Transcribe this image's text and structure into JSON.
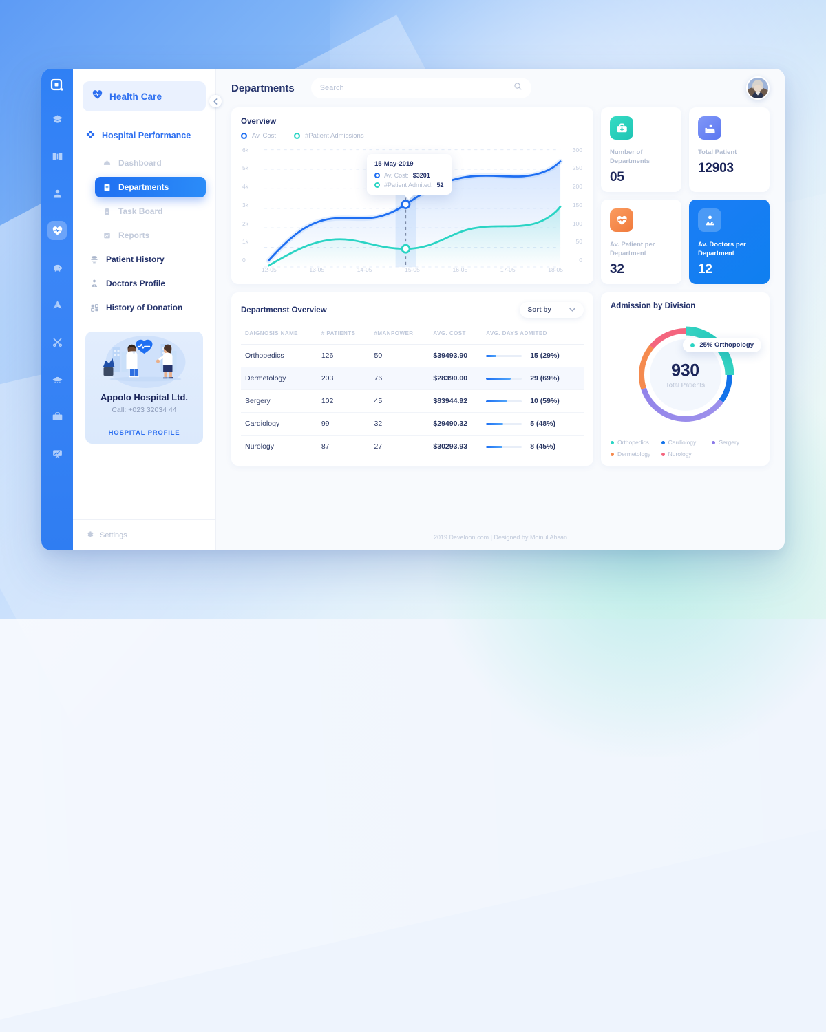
{
  "rail": {
    "logo_icon": "app-logo-icon",
    "items": [
      {
        "icon": "graduation-cap-icon",
        "active": false
      },
      {
        "icon": "book-open-icon",
        "active": false
      },
      {
        "icon": "user-badge-icon",
        "active": false
      },
      {
        "icon": "heart-pulse-icon",
        "active": true
      },
      {
        "icon": "piggy-bank-icon",
        "active": false
      },
      {
        "icon": "paper-plane-icon",
        "active": false
      },
      {
        "icon": "tools-icon",
        "active": false
      },
      {
        "icon": "ufo-icon",
        "active": false
      },
      {
        "icon": "briefcase-icon",
        "active": false
      },
      {
        "icon": "presentation-chart-icon",
        "active": false
      }
    ]
  },
  "sidebar": {
    "brand": {
      "label": "Health Care",
      "icon": "heart-pulse-icon"
    },
    "collapse_icon": "chevron-left-icon",
    "group_title": {
      "label": "Hospital Performance",
      "icon": "medical-cross-icon"
    },
    "items": [
      {
        "label": "Dashboard",
        "icon": "dashboard-icon",
        "active": false,
        "level": 2
      },
      {
        "label": "Departments",
        "icon": "departments-icon",
        "active": true,
        "level": 2
      },
      {
        "label": "Task Board",
        "icon": "task-board-icon",
        "active": false,
        "level": 2
      },
      {
        "label": "Reports",
        "icon": "reports-icon",
        "active": false,
        "level": 2
      },
      {
        "label": "Patient History",
        "icon": "patient-history-icon",
        "active": false,
        "level": 1
      },
      {
        "label": "Doctors Profile",
        "icon": "doctor-profile-icon",
        "active": false,
        "level": 1
      },
      {
        "label": "History of Donation",
        "icon": "donation-grid-icon",
        "active": false,
        "level": 1
      }
    ],
    "hospital_card": {
      "name": "Appolo Hospital Ltd.",
      "call": "Call: +023 32034 44",
      "button": "HOSPITAL PROFILE"
    },
    "settings": {
      "label": "Settings",
      "icon": "gear-icon"
    }
  },
  "topbar": {
    "title": "Departments",
    "search": {
      "value": "",
      "placeholder": "Search",
      "icon": "search-icon"
    },
    "avatar": "user-avatar"
  },
  "chart_data": {
    "type": "line",
    "title": "Overview",
    "x": [
      "12-05",
      "13-05",
      "14-05",
      "15-05",
      "16-05",
      "17-05",
      "18-05"
    ],
    "xlabel": "",
    "grid": true,
    "legend_position": "top-left",
    "series": [
      {
        "name": "Av. Cost",
        "color": "#1f6ff2",
        "axis": "left",
        "ylabel": "Av. Cost",
        "ylim": [
          0,
          6000
        ],
        "yticks": [
          "0",
          "1k",
          "2k",
          "3k",
          "4k",
          "5k",
          "6k"
        ],
        "values": [
          300,
          2450,
          2400,
          3201,
          4450,
          4350,
          5100
        ]
      },
      {
        "name": "#Patient Admissions",
        "color": "#2ad4c4",
        "axis": "right",
        "ylabel": "#Patient Admissions",
        "ylim": [
          0,
          300
        ],
        "yticks": [
          "0",
          "50",
          "100",
          "150",
          "200",
          "250",
          "300"
        ],
        "values": [
          12,
          88,
          72,
          52,
          110,
          130,
          152
        ]
      }
    ],
    "tooltip": {
      "date": "15-May-2019",
      "rows": [
        {
          "label": "Av. Cost:",
          "value": "$3201",
          "color": "#1f6ff2"
        },
        {
          "label": "#Patient Admited:",
          "value": "52",
          "color": "#2ad4c4"
        }
      ]
    }
  },
  "stats": [
    {
      "label": "Number of Departments",
      "value": "05",
      "icon": "medical-bag-icon",
      "icon_bg": "#2fd0bd",
      "accent": false
    },
    {
      "label": "Total Patient",
      "value": "12903",
      "icon": "patient-bed-icon",
      "icon_bg": "#6d8bf5",
      "accent": false
    },
    {
      "label": "Av. Patient per Department",
      "value": "32",
      "icon": "heart-beat-icon",
      "icon_bg": "#f58a4e",
      "accent": false
    },
    {
      "label": "Av. Doctors per Department",
      "value": "12",
      "icon": "doctor-icon",
      "icon_bg": "#ffffff",
      "accent": true
    }
  ],
  "table": {
    "title": "Departmenst Overview",
    "sort_by": {
      "label": "Sort by",
      "icon": "chevron-down-icon"
    },
    "columns": [
      "DAIGNOSIS NAME",
      "# PATIENTS",
      "#MANPOWER",
      "AVG. COST",
      "AVG. DAYS ADMITED"
    ],
    "rows": [
      {
        "name": "Orthopedics",
        "patients": "126",
        "manpower": "50",
        "cost": "$39493.90",
        "days": "15 (29%)",
        "pct": 29,
        "highlight": false
      },
      {
        "name": "Dermetology",
        "patients": "203",
        "manpower": "76",
        "cost": "$28390.00",
        "days": "29 (69%)",
        "pct": 69,
        "highlight": true
      },
      {
        "name": "Sergery",
        "patients": "102",
        "manpower": "45",
        "cost": "$83944.92",
        "days": "10 (59%)",
        "pct": 59,
        "highlight": false
      },
      {
        "name": "Cardiology",
        "patients": "99",
        "manpower": "32",
        "cost": "$29490.32",
        "days": "5 (48%)",
        "pct": 48,
        "highlight": false
      },
      {
        "name": "Nurology",
        "patients": "87",
        "manpower": "27",
        "cost": "$30293.93",
        "days": "8 (45%)",
        "pct": 45,
        "highlight": false
      }
    ]
  },
  "donut_chart": {
    "type": "pie",
    "title": "Admission by Division",
    "center_value": "930",
    "center_label": "Total Patients",
    "tooltip": {
      "text": "25% Orthopology",
      "color": "#2ad4c4"
    },
    "categories": [
      "Orthopedics",
      "Cardiology",
      "Sergery",
      "Dermetology",
      "Nurology"
    ],
    "values": [
      25,
      10,
      35,
      16,
      14
    ],
    "colors": [
      "#2ad4c4",
      "#1273ea",
      "#8b7ae8",
      "#f58a4e",
      "#f4657e"
    ],
    "legend": [
      {
        "label": "Orthopedics",
        "color": "#2ad4c4"
      },
      {
        "label": "Cardiology",
        "color": "#1273ea"
      },
      {
        "label": "Sergery",
        "color": "#8b7ae8"
      },
      {
        "label": "Dermetology",
        "color": "#f58a4e"
      },
      {
        "label": "Nurology",
        "color": "#f4657e"
      }
    ]
  },
  "footer": {
    "text": "2019 Develoon.com | Designed by Moinul Ahsan"
  }
}
